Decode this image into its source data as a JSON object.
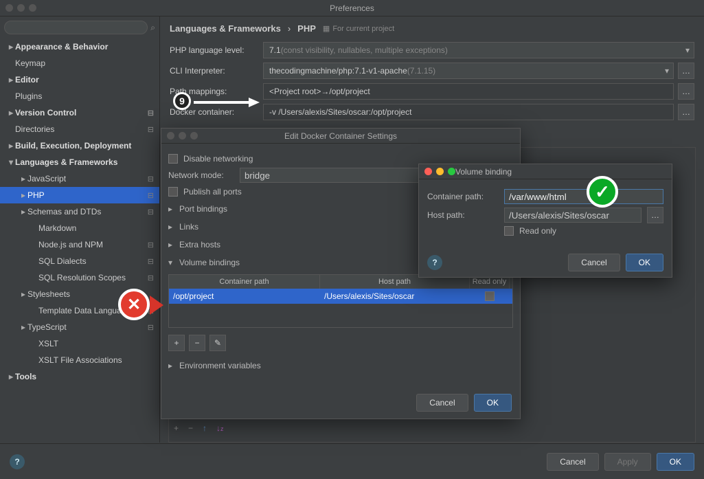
{
  "window": {
    "title": "Preferences"
  },
  "search": {
    "placeholder": ""
  },
  "sidebar": [
    {
      "label": "Appearance & Behavior",
      "bold": true,
      "arrow": "▸",
      "lvl": 0
    },
    {
      "label": "Keymap",
      "lvl": 0
    },
    {
      "label": "Editor",
      "bold": true,
      "arrow": "▸",
      "lvl": 0
    },
    {
      "label": "Plugins",
      "lvl": 0
    },
    {
      "label": "Version Control",
      "bold": true,
      "arrow": "▸",
      "lvl": 0,
      "cog": true
    },
    {
      "label": "Directories",
      "lvl": 0,
      "cog": true
    },
    {
      "label": "Build, Execution, Deployment",
      "bold": true,
      "arrow": "▸",
      "lvl": 0
    },
    {
      "label": "Languages & Frameworks",
      "bold": true,
      "arrow": "▾",
      "lvl": 0
    },
    {
      "label": "JavaScript",
      "arrow": "▸",
      "lvl": 1,
      "cog": true
    },
    {
      "label": "PHP",
      "arrow": "▸",
      "lvl": 1,
      "sel": true,
      "cog": true
    },
    {
      "label": "Schemas and DTDs",
      "arrow": "▸",
      "lvl": 1,
      "cog": true
    },
    {
      "label": "Markdown",
      "lvl": 2
    },
    {
      "label": "Node.js and NPM",
      "lvl": 2,
      "cog": true
    },
    {
      "label": "SQL Dialects",
      "lvl": 2,
      "cog": true
    },
    {
      "label": "SQL Resolution Scopes",
      "lvl": 2,
      "cog": true
    },
    {
      "label": "Stylesheets",
      "arrow": "▸",
      "lvl": 1
    },
    {
      "label": "Template Data Languages",
      "lvl": 2,
      "cog": true
    },
    {
      "label": "TypeScript",
      "arrow": "▸",
      "lvl": 1,
      "cog": true
    },
    {
      "label": "XSLT",
      "lvl": 2
    },
    {
      "label": "XSLT File Associations",
      "lvl": 2
    },
    {
      "label": "Tools",
      "bold": true,
      "arrow": "▸",
      "lvl": 0
    }
  ],
  "breadcrumb": {
    "root": "Languages & Frameworks",
    "leaf": "PHP",
    "hint": "For current project"
  },
  "form": {
    "lang_label": "PHP language level:",
    "lang_value": "7.1",
    "lang_dim": " (const visibility, nullables, multiple exceptions)",
    "cli_label": "CLI Interpreter:",
    "cli_value": "thecodingmachine/php:7.1-v1-apache",
    "cli_dim": " (7.1.15)",
    "map_label": "Path mappings:",
    "map_value": "<Project root>→/opt/project",
    "docker_label": "Docker container:",
    "docker_value": "-v /Users/alexis/Sites/oscar:/opt/project"
  },
  "footer": {
    "cancel": "Cancel",
    "apply": "Apply",
    "ok": "OK"
  },
  "dlg1": {
    "title": "Edit Docker Container Settings",
    "disable_net": "Disable networking",
    "net_mode_label": "Network mode:",
    "net_mode_value": "bridge",
    "publish_all": "Publish all ports",
    "sec_port": "Port bindings",
    "sec_links": "Links",
    "sec_hosts": "Extra hosts",
    "sec_vol": "Volume bindings",
    "th_container": "Container path",
    "th_host": "Host path",
    "th_ro": "Read only",
    "row_container": "/opt/project",
    "row_host": "/Users/alexis/Sites/oscar",
    "sec_env": "Environment variables",
    "cancel": "Cancel",
    "ok": "OK"
  },
  "dlg2": {
    "title": "Volume binding",
    "cp_label": "Container path:",
    "cp_value": "/var/www/html",
    "hp_label": "Host path:",
    "hp_value": "/Users/alexis/Sites/oscar",
    "ro": "Read only",
    "cancel": "Cancel",
    "ok": "OK"
  },
  "anno": {
    "nine": "9"
  }
}
